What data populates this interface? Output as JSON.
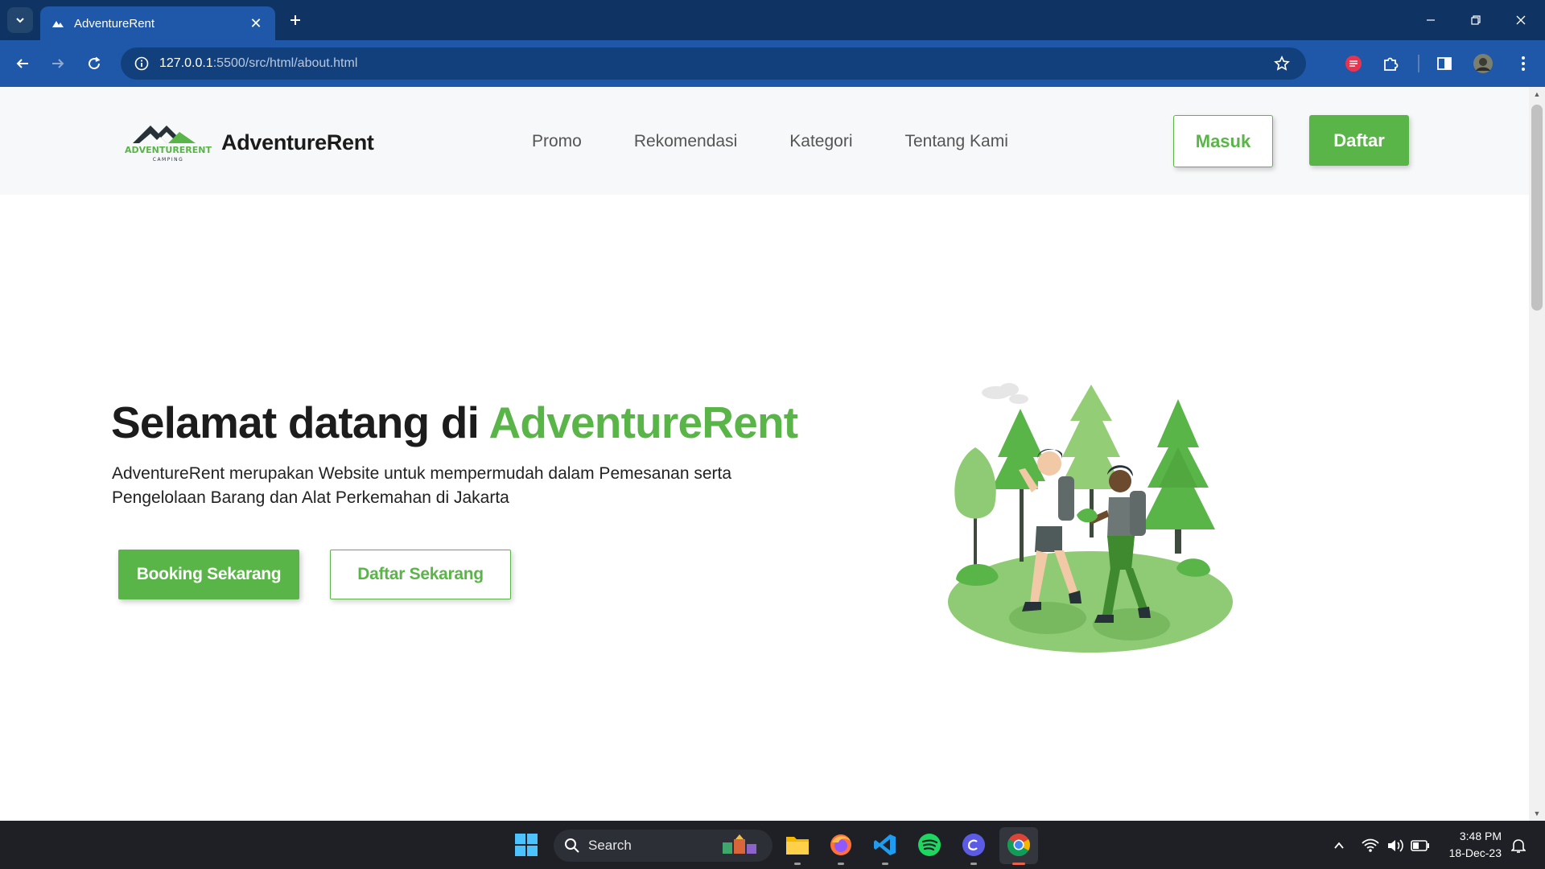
{
  "browser": {
    "tab_title": "AdventureRent",
    "url_host": "127.0.0.1",
    "url_path": ":5500/src/html/about.html"
  },
  "site": {
    "logo_text_main": "ADVENTURERENT",
    "logo_text_sub": "CAMPING",
    "brand_name": "AdventureRent",
    "nav": [
      "Promo",
      "Rekomendasi",
      "Kategori",
      "Tentang Kami"
    ],
    "login_label": "Masuk",
    "register_label": "Daftar",
    "accent_color": "#5ab548"
  },
  "hero": {
    "title_prefix": "Selamat datang di ",
    "title_accent": "AdventureRent",
    "description": "AdventureRent merupakan Website untuk mempermudah dalam Pemesanan serta Pengelolaan Barang dan Alat Perkemahan di Jakarta",
    "primary_button": "Booking Sekarang",
    "secondary_button": "Daftar Sekarang"
  },
  "taskbar": {
    "search_label": "Search",
    "time": "3:48 PM",
    "date": "18-Dec-23",
    "apps": [
      "start-icon",
      "file-explorer-icon",
      "firefox-icon",
      "vscode-icon",
      "spotify-icon",
      "canva-icon",
      "chrome-icon"
    ]
  }
}
